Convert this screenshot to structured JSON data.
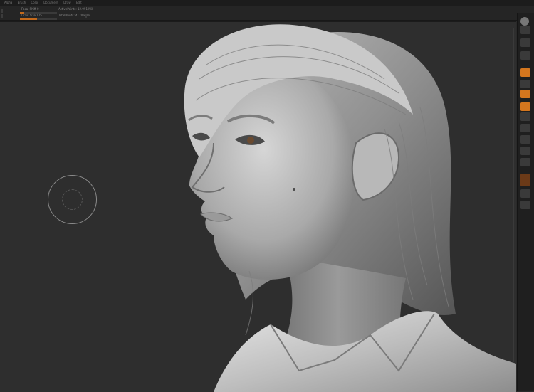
{
  "menu": [
    "Alpha",
    "Brush",
    "Color",
    "Document",
    "Draw",
    "Edit"
  ],
  "toolbar": {
    "focal_label": "Focal Shift 0",
    "draw_label": "Draw Size 175",
    "active_points": "ActivePoints: 12.991 Mil",
    "total_points": "TotalPoints: 41.008 Mil"
  },
  "shelf": {
    "buttons": [
      "bpr-icon",
      "spix-icon",
      "scroll-icon",
      "zoom-icon",
      "actual-icon",
      "aahalf-icon",
      "persp-icon",
      "floor-icon",
      "local-icon",
      "xyz-icon",
      "frame-icon",
      "move-icon",
      "scale-icon",
      "rotate-icon",
      "polyf-icon",
      "transp-icon",
      "ghost-icon",
      "solo-icon",
      "xpose-icon"
    ]
  },
  "colors": {
    "accent": "#d4761e",
    "bg": "#2e2e2e",
    "shelf": "#1f1f1f"
  }
}
